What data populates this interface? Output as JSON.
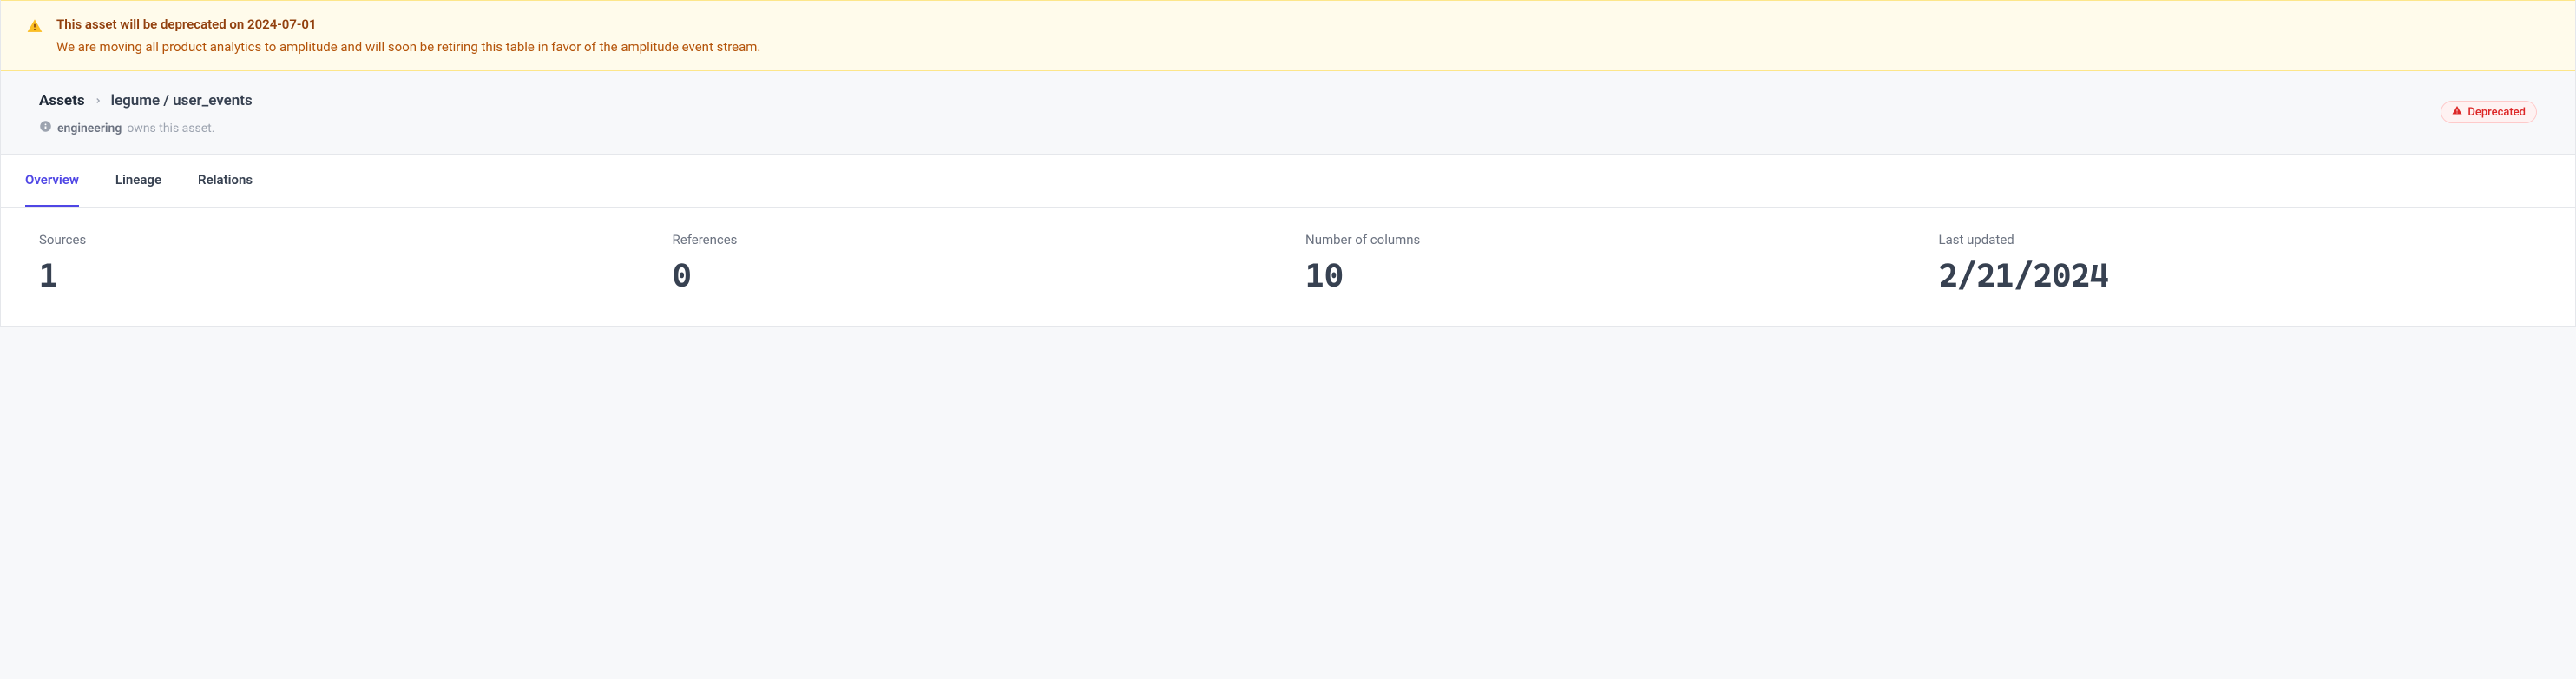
{
  "banner": {
    "title": "This asset will be deprecated on 2024-07-01",
    "description": "We are moving all product analytics to amplitude and will soon be retiring this table in favor of the amplitude event stream."
  },
  "breadcrumb": {
    "root": "Assets",
    "path": "legume / user_events"
  },
  "owner": {
    "name": "engineering",
    "suffix": "owns this asset."
  },
  "badge": {
    "label": "Deprecated"
  },
  "tabs": [
    {
      "label": "Overview",
      "active": true
    },
    {
      "label": "Lineage",
      "active": false
    },
    {
      "label": "Relations",
      "active": false
    }
  ],
  "stats": {
    "sources": {
      "label": "Sources",
      "value": "1"
    },
    "references": {
      "label": "References",
      "value": "0"
    },
    "columns": {
      "label": "Number of columns",
      "value": "10"
    },
    "updated": {
      "label": "Last updated",
      "value": "2/21/2024"
    }
  }
}
